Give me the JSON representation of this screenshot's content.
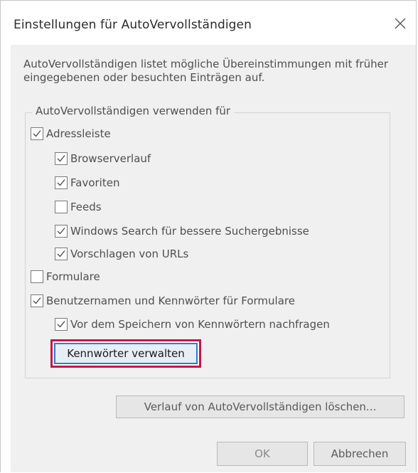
{
  "dialog": {
    "title": "Einstellungen für AutoVervollständigen",
    "close_icon": "close-icon"
  },
  "description": "AutoVervollständigen listet mögliche Übereinstimmungen mit früher eingegebenen oder besuchten Einträgen auf.",
  "group": {
    "legend": "AutoVervollständigen verwenden für",
    "items": [
      {
        "label": "Adressleiste",
        "checked": true
      },
      {
        "label": "Browserverlauf",
        "checked": true
      },
      {
        "label": "Favoriten",
        "checked": true
      },
      {
        "label": "Feeds",
        "checked": false
      },
      {
        "label": "Windows Search für bessere Suchergebnisse",
        "checked": true
      },
      {
        "label": "Vorschlagen von URLs",
        "checked": true
      },
      {
        "label": "Formulare",
        "checked": false
      },
      {
        "label": "Benutzernamen und Kennwörter für Formulare",
        "checked": true
      },
      {
        "label": "Vor dem Speichern von Kennwörtern nachfragen",
        "checked": true
      }
    ],
    "manage_button": "Kennwörter verwalten"
  },
  "buttons": {
    "clear_history": "Verlauf von AutoVervollständigen löschen...",
    "ok": "OK",
    "cancel": "Abbrechen"
  },
  "colors": {
    "highlight_border": "#c8144a",
    "focus_border": "#2f7bd5",
    "dialog_background": "#f0f0f0"
  }
}
